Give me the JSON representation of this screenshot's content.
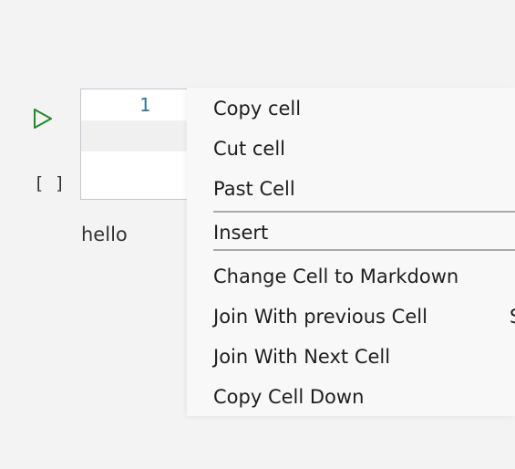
{
  "cell": {
    "run_icon": "play-icon",
    "execution_count": "[ ]",
    "line_number": "1",
    "output": "hello"
  },
  "context_menu": {
    "items": [
      {
        "label": "Copy cell"
      },
      {
        "label": "Cut cell"
      },
      {
        "label": "Past Cell"
      },
      {
        "label": "Insert"
      },
      {
        "label": "Change Cell to Markdown"
      },
      {
        "label": "Join With previous Cell",
        "shortcut": "S"
      },
      {
        "label": "Join With Next Cell"
      },
      {
        "label": "Copy Cell Down"
      }
    ]
  },
  "colors": {
    "run_icon": "#1e8a28",
    "line_number": "#237893",
    "menu_background": "#f8f8f8",
    "divider": "#a9a9a9"
  }
}
